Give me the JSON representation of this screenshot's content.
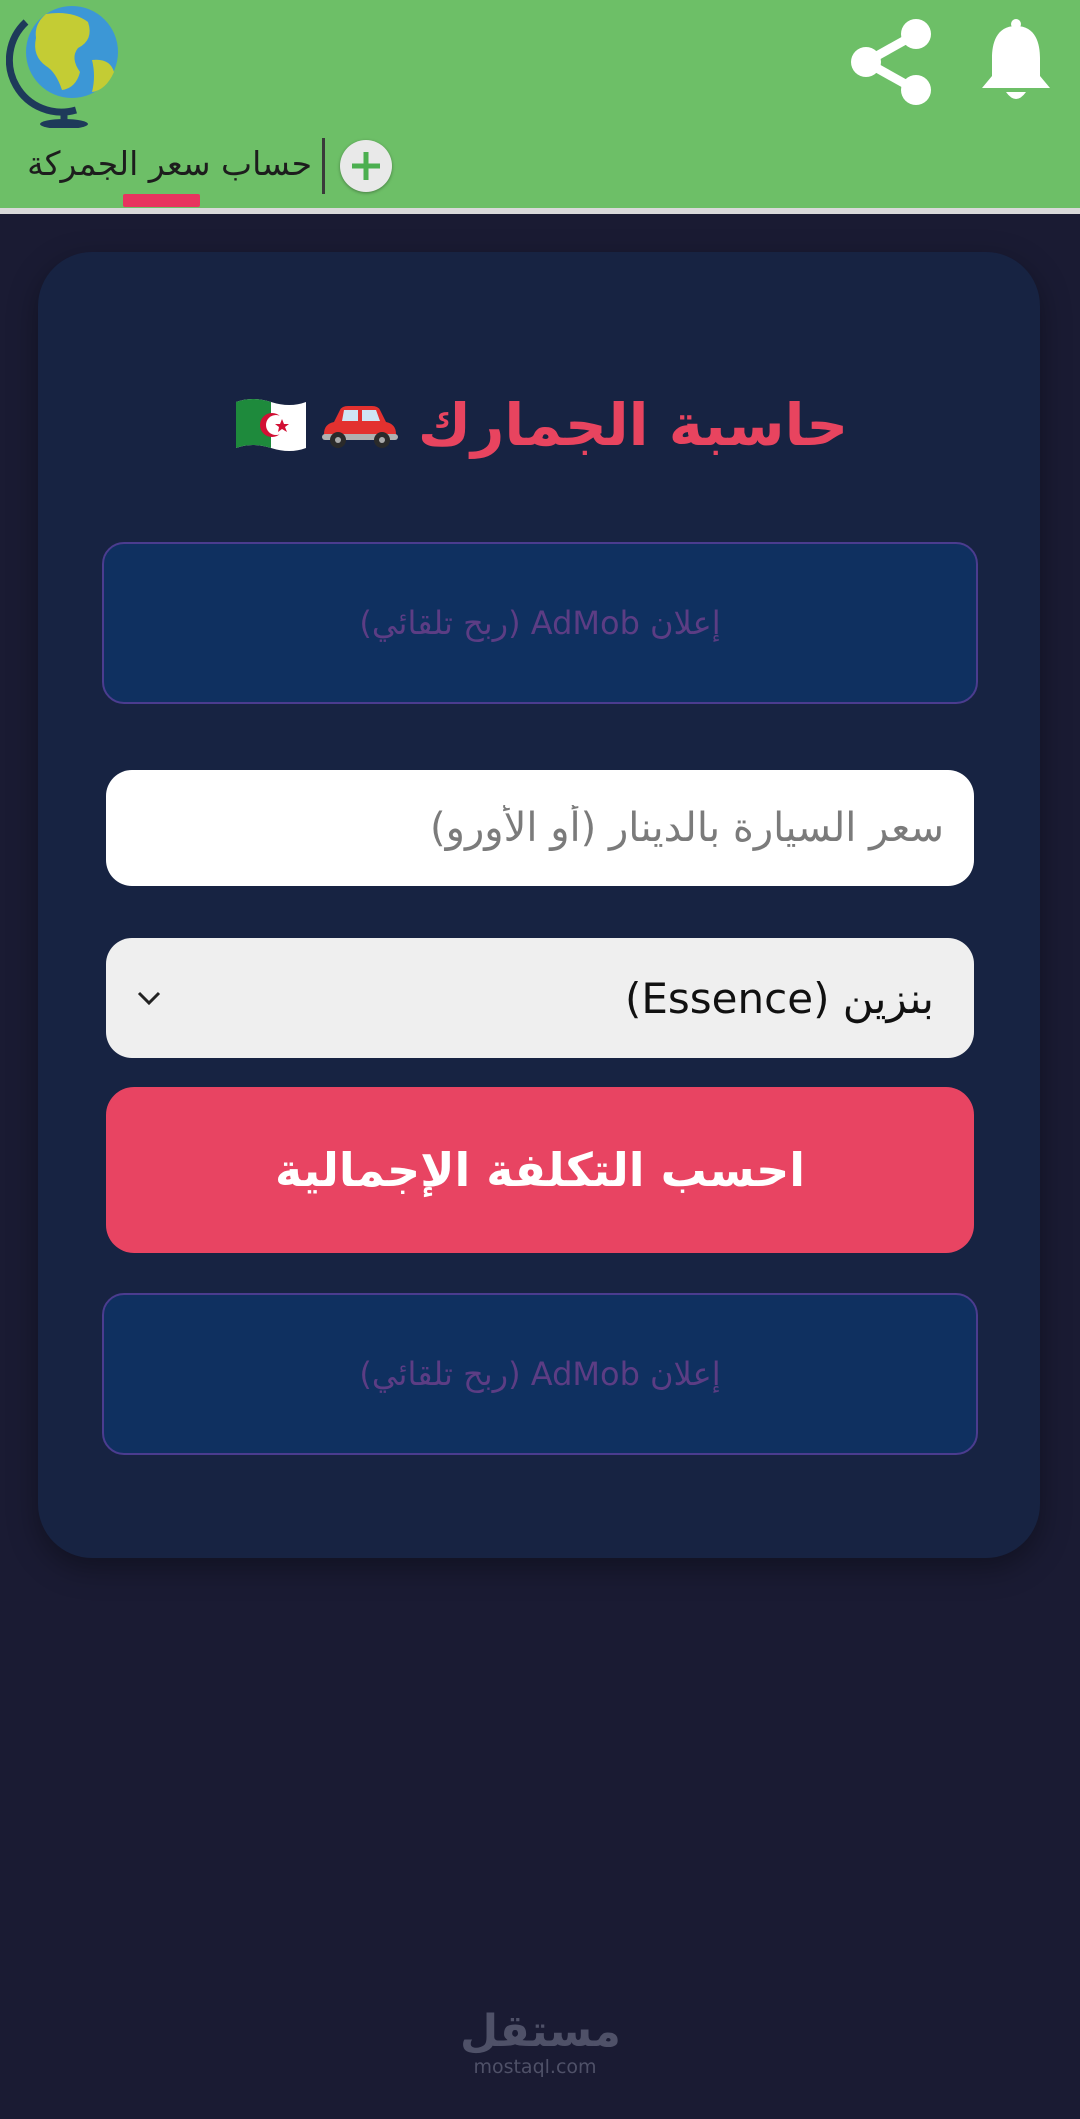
{
  "appbar": {
    "color": "#6dbf67",
    "tab_label": "حساب سعر الجمركة",
    "tab_indicator_color": "#e8345f",
    "icons": [
      "globe-icon",
      "share-icon",
      "bell-icon",
      "add-tab-icon"
    ]
  },
  "card": {
    "title": "حاسبة الجمارك",
    "title_emoji": [
      "car-icon",
      "algeria-flag-icon"
    ],
    "ad_top": "إعلان AdMob (ربح تلقائي)",
    "price_placeholder": "سعر السيارة بالدينار (أو الأورو)",
    "price_value": "",
    "fuel_select": "بنزين (Essence)",
    "calc_button": "احسب التكلفة الإجمالية",
    "ad_bottom": "إعلان AdMob (ربح تلقائي)"
  },
  "watermark": {
    "arabic": "مستقل",
    "domain": "mostaql.com"
  },
  "colors": {
    "background": "#1a1b33",
    "card": "#172342",
    "accent": "#e84462",
    "ad_box": "#0f3060",
    "ad_text": "#5c3d84"
  }
}
